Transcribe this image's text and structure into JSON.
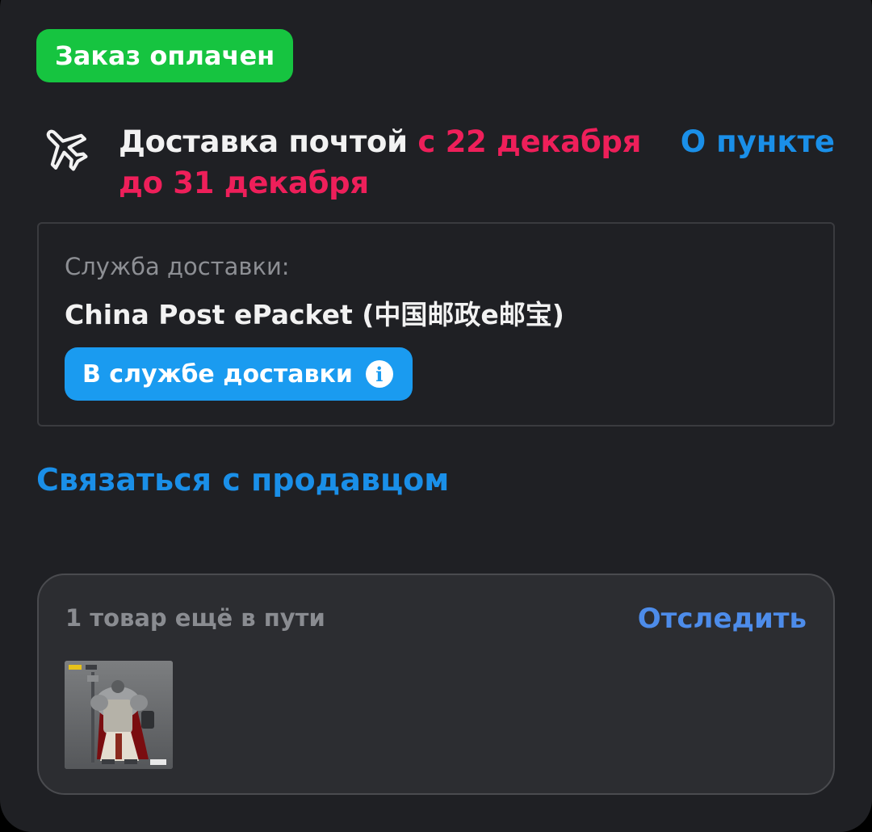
{
  "order": {
    "status_badge": "Заказ оплачен"
  },
  "delivery": {
    "icon": "airplane-icon",
    "title_prefix": "Доставка почтой ",
    "dates": "с 22 декабря до 31 декабря",
    "about_link": "О пункте"
  },
  "service": {
    "label": "Служба доставки:",
    "name": "China Post ePacket (中国邮政e邮宝)",
    "status": "В службе доставки",
    "status_icon": "info-icon"
  },
  "contact_seller": "Связаться с продавцом",
  "transit": {
    "label": "1 товар ещё в пути",
    "track_link": "Отследить",
    "product_image": "figure-thumbnail"
  },
  "colors": {
    "background": "#1f2024",
    "success": "#16c440",
    "accent_red": "#ee1f5a",
    "link_blue": "#1a8fe8",
    "pill_blue": "#1a9bf0"
  }
}
